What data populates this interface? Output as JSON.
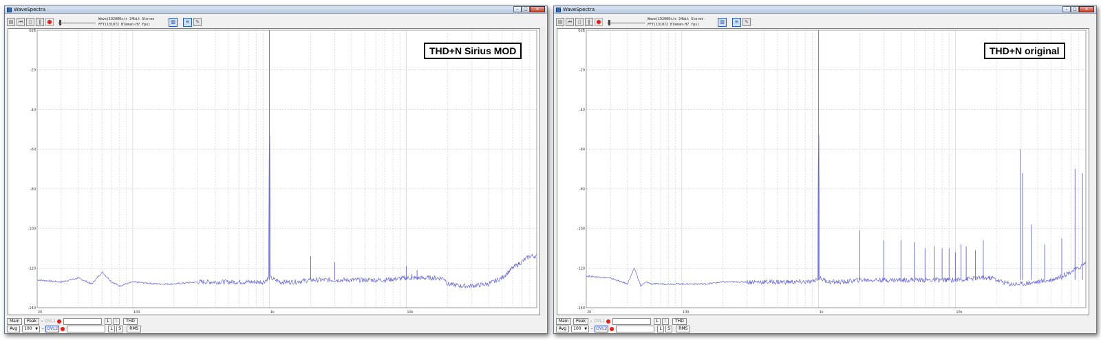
{
  "app": {
    "title": "WaveSpectra"
  },
  "toolbar": {
    "source_line": "Wave(192000s/s 24bit Stereo",
    "fft_line": "FFT(131072 Blkman-H7 fps)"
  },
  "panes": [
    {
      "label": "THD+N Sirius MOD"
    },
    {
      "label": "THD+N original"
    }
  ],
  "axis": {
    "y_ticks": [
      "0dB",
      "-20",
      "-40",
      "-60",
      "-80",
      "-100",
      "-120",
      "-140"
    ],
    "x_ticks": [
      "20",
      "100",
      "1k",
      "10k"
    ]
  },
  "bottom": {
    "main_label": "Main",
    "peak_label": "Peak",
    "avg_label": "Avg",
    "avg_value": "100",
    "ovl1_label": "OVL1",
    "ovl2_label": "OVL2",
    "l_label": "L",
    "s_label": "S",
    "thd_label": "THD",
    "rms_label": "RMS"
  },
  "colors": {
    "trace": "#6464d2",
    "grid": "#c8c8c8",
    "rec": "#e31b1b"
  },
  "chart_data": [
    {
      "type": "line",
      "title": "THD+N Sirius MOD",
      "x_scale": "log",
      "xlim": [
        20,
        90000
      ],
      "ylim": [
        -140,
        0
      ],
      "x_ticks": [
        20,
        100,
        1000,
        10000
      ],
      "y_ticks": [
        0,
        -20,
        -40,
        -60,
        -80,
        -100,
        -120,
        -140
      ],
      "grid": true,
      "series": [
        {
          "x": [
            20,
            30,
            40,
            50,
            60,
            70,
            80,
            100,
            150,
            200,
            300,
            500,
            700,
            900,
            990,
            1000,
            1010,
            1200,
            1500,
            2000,
            3000,
            4000,
            5000,
            7000,
            10000,
            15000,
            19000,
            20000,
            25000,
            30000,
            40000,
            50000,
            60000,
            80000,
            90000
          ],
          "y": [
            -126,
            -127,
            -125,
            -128,
            -122,
            -127,
            -129,
            -127,
            -128,
            -128,
            -127,
            -127,
            -127,
            -127,
            -125,
            0,
            -125,
            -127,
            -127,
            -126,
            -126,
            -126,
            -126,
            -126,
            -125,
            -125,
            -125,
            -128,
            -129,
            -129,
            -128,
            -125,
            -120,
            -114,
            -114
          ]
        }
      ],
      "harmonic_peaks": [
        {
          "x": 1000,
          "y": 0
        },
        {
          "x": 2000,
          "y": -114
        },
        {
          "x": 3000,
          "y": -117
        },
        {
          "x": 10000,
          "y": -119
        },
        {
          "x": 11000,
          "y": -123
        },
        {
          "x": 12000,
          "y": -121
        }
      ]
    },
    {
      "type": "line",
      "title": "THD+N original",
      "x_scale": "log",
      "xlim": [
        20,
        90000
      ],
      "ylim": [
        -140,
        0
      ],
      "x_ticks": [
        20,
        100,
        1000,
        10000
      ],
      "y_ticks": [
        0,
        -20,
        -40,
        -60,
        -80,
        -100,
        -120,
        -140
      ],
      "grid": true,
      "series": [
        {
          "x": [
            20,
            30,
            40,
            45,
            50,
            55,
            60,
            70,
            80,
            100,
            150,
            200,
            300,
            500,
            700,
            900,
            990,
            1000,
            1010,
            1200,
            1500,
            2000,
            3000,
            5000,
            7000,
            10000,
            15000,
            19000,
            20000,
            25000,
            30000,
            40000,
            50000,
            60000,
            80000,
            90000
          ],
          "y": [
            -124,
            -125,
            -128,
            -120,
            -129,
            -127,
            -128,
            -128,
            -128,
            -128,
            -128,
            -127,
            -127,
            -127,
            -127,
            -127,
            -125,
            0,
            -125,
            -127,
            -127,
            -126,
            -126,
            -126,
            -126,
            -126,
            -125,
            -125,
            -126,
            -128,
            -128,
            -127,
            -126,
            -124,
            -120,
            -117
          ]
        }
      ],
      "harmonic_peaks": [
        {
          "x": 1000,
          "y": 0
        },
        {
          "x": 2000,
          "y": -101
        },
        {
          "x": 3000,
          "y": -106
        },
        {
          "x": 4000,
          "y": -106
        },
        {
          "x": 5000,
          "y": -107
        },
        {
          "x": 6000,
          "y": -110
        },
        {
          "x": 7000,
          "y": -109
        },
        {
          "x": 8000,
          "y": -110
        },
        {
          "x": 9000,
          "y": -110
        },
        {
          "x": 10000,
          "y": -112
        },
        {
          "x": 11000,
          "y": -108
        },
        {
          "x": 12000,
          "y": -109
        },
        {
          "x": 14000,
          "y": -111
        },
        {
          "x": 16000,
          "y": -106
        },
        {
          "x": 30000,
          "y": -60
        },
        {
          "x": 31000,
          "y": -72
        },
        {
          "x": 36000,
          "y": -98
        },
        {
          "x": 45000,
          "y": -108
        },
        {
          "x": 60000,
          "y": -105
        },
        {
          "x": 75000,
          "y": -70
        },
        {
          "x": 85000,
          "y": -72
        }
      ]
    }
  ]
}
